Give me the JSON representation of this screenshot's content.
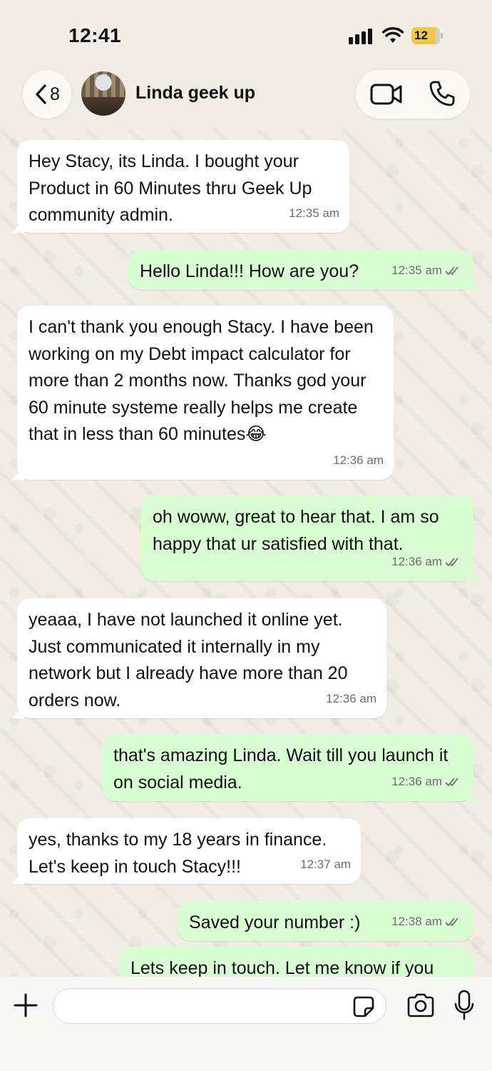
{
  "status_bar": {
    "time": "12:41",
    "battery": "12"
  },
  "header": {
    "back_count": "8",
    "contact_name": "Linda geek up",
    "icons": [
      "chevron-left-icon",
      "video-call-icon",
      "phone-icon"
    ]
  },
  "messages": [
    {
      "direction": "in",
      "text": "Hey Stacy, its Linda. I bought your Product in 60 Minutes thru Geek Up community admin.",
      "time": "12:35 am"
    },
    {
      "direction": "out",
      "text": "Hello Linda!!! How are you?",
      "time": "12:35 am",
      "read": true
    },
    {
      "direction": "in",
      "text": "I can't thank you enough Stacy. I have been working on my Debt impact calculator for more than 2 months now. Thanks god your 60 minute systeme really helps me create that in less than 60 minutes😂",
      "time": "12:36 am"
    },
    {
      "direction": "out",
      "text": "oh woww, great to hear that. I am so happy that ur satisfied with that.",
      "time": "12:36 am",
      "read": true
    },
    {
      "direction": "in",
      "text": "yeaaa, I have not launched it online yet. Just communicated it internally in my network but I already have more than 20 orders now.",
      "time": "12:36 am"
    },
    {
      "direction": "out",
      "text": "that's amazing Linda. Wait till you launch it on social media.",
      "time": "12:36 am",
      "read": true
    },
    {
      "direction": "in",
      "text": "yes, thanks to my 18 years in finance. Let's keep in touch Stacy!!!",
      "time": "12:37 am"
    },
    {
      "direction": "out",
      "text": "Saved your number :)",
      "time": "12:38 am",
      "read": true
    },
    {
      "direction": "out",
      "text": "Lets keep in touch. Let me know if you",
      "time": "",
      "read": false
    }
  ],
  "composer": {
    "placeholder": "",
    "icons": [
      "plus-icon",
      "sticker-icon",
      "camera-icon",
      "microphone-icon"
    ]
  },
  "colors": {
    "incoming_bubble": "#ffffff",
    "outgoing_bubble": "#d9fdd3",
    "wallpaper": "#f1ede4"
  }
}
